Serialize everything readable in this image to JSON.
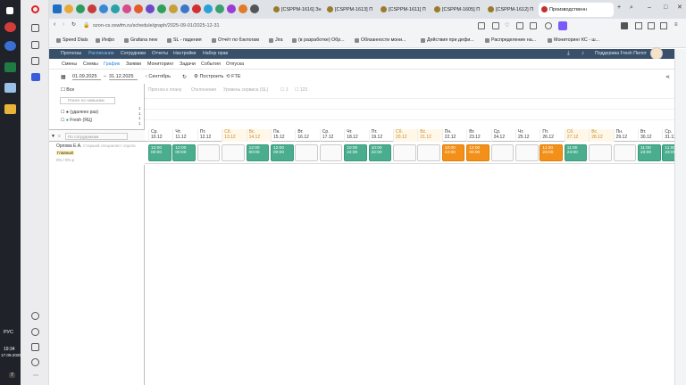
{
  "taskbar": {
    "lang": "РУС",
    "time": "19:34",
    "date": "17.09.2025",
    "notif": "7"
  },
  "opera_sidebar": {
    "badge": "91"
  },
  "tabs": [
    {
      "label": "[CSPPM-1616] Зн"
    },
    {
      "label": "[CSPPM-1613] П"
    },
    {
      "label": "[CSPPM-1611] П"
    },
    {
      "label": "[CSPPM-1605] П"
    },
    {
      "label": "[CSPPM-1612] П"
    },
    {
      "label": "Производственн"
    }
  ],
  "address": {
    "url": "ozon-cs.oswfm.ru/schedule/graph/2025-09-01/2025-12-31"
  },
  "bookmarks": [
    {
      "label": "Speed Dials"
    },
    {
      "label": "Инфо"
    },
    {
      "label": "Grafana new"
    },
    {
      "label": "SL - падения"
    },
    {
      "label": "Отчёт по бэклогам"
    },
    {
      "label": "Jira"
    },
    {
      "label": "(в разработке) Обр..."
    },
    {
      "label": "Обязанности мони..."
    },
    {
      "label": "Действия при дефи..."
    },
    {
      "label": "Распределение на..."
    },
    {
      "label": "Мониторинг КС - ш..."
    }
  ],
  "appnav": {
    "items": [
      "Прогнозы",
      "Расписание",
      "Сотрудники",
      "Отчеты",
      "Настройки",
      "Набор прав"
    ],
    "support": "Поддержка Fresh Пилот"
  },
  "subnav": {
    "items": [
      "Смены",
      "Схемы",
      "График",
      "Заявки",
      "Мониторинг",
      "Задачи",
      "События",
      "Отпуска"
    ]
  },
  "toolbar": {
    "date_from": "01.09.2025",
    "date_to": "31.12.2025",
    "month": "Сентябрь",
    "build": "Построить",
    "fte": "FTE"
  },
  "chart_tabs": {
    "forecast": "Прогноз к плану",
    "deviation": "Отклонения",
    "sl": "Уровень сервиса (SL)",
    "cb1": "1",
    "cb2": "123"
  },
  "filters": {
    "all": "Все",
    "search_ph": "Поиск по навыкам",
    "skill1": "(удалено раз)",
    "skill2": "Fresh (ЯЦ)",
    "emp_search_ph": "По сотрудникам"
  },
  "employee": {
    "name": "Орлова Е.А.",
    "role": "Старший специалист отдела",
    "tag": "Главный",
    "extra": "0% / 0% р"
  },
  "days": [
    {
      "wd": "Ср.",
      "d": "10.12",
      "we": false
    },
    {
      "wd": "Чт.",
      "d": "11.12",
      "we": false
    },
    {
      "wd": "Пт.",
      "d": "12.12",
      "we": false
    },
    {
      "wd": "Сб.",
      "d": "13.12",
      "we": true
    },
    {
      "wd": "Вс.",
      "d": "14.12",
      "we": true
    },
    {
      "wd": "Пн.",
      "d": "15.12",
      "we": false
    },
    {
      "wd": "Вт.",
      "d": "16.12",
      "we": false
    },
    {
      "wd": "Ср.",
      "d": "17.12",
      "we": false
    },
    {
      "wd": "Чт.",
      "d": "18.12",
      "we": false
    },
    {
      "wd": "Пт.",
      "d": "19.12",
      "we": false
    },
    {
      "wd": "Сб.",
      "d": "20.12",
      "we": true
    },
    {
      "wd": "Вс.",
      "d": "21.12",
      "we": true
    },
    {
      "wd": "Пн.",
      "d": "22.12",
      "we": false
    },
    {
      "wd": "Вт.",
      "d": "23.12",
      "we": false
    },
    {
      "wd": "Ср.",
      "d": "24.12",
      "we": false
    },
    {
      "wd": "Чт.",
      "d": "25.12",
      "we": false
    },
    {
      "wd": "Пт.",
      "d": "26.12",
      "we": false
    },
    {
      "wd": "Сб.",
      "d": "27.12",
      "we": true
    },
    {
      "wd": "Вс.",
      "d": "28.12",
      "we": true
    },
    {
      "wd": "Пн.",
      "d": "29.12",
      "we": false
    },
    {
      "wd": "Вт.",
      "d": "30.12",
      "we": false
    },
    {
      "wd": "Ср.",
      "d": "31.12",
      "we": false
    }
  ],
  "shifts": [
    {
      "t": "g",
      "a": "12:00",
      "b": "00:00"
    },
    {
      "t": "g",
      "a": "12:00",
      "b": "00:00"
    },
    {
      "t": "e"
    },
    {
      "t": "e"
    },
    {
      "t": "g",
      "a": "12:00",
      "b": "00:00"
    },
    {
      "t": "g",
      "a": "12:00",
      "b": "00:00"
    },
    {
      "t": "e"
    },
    {
      "t": "e"
    },
    {
      "t": "g",
      "a": "10:00",
      "b": "22:00"
    },
    {
      "t": "g",
      "a": "10:00",
      "b": "22:00"
    },
    {
      "t": "e"
    },
    {
      "t": "e"
    },
    {
      "t": "o",
      "a": "10:00",
      "b": "22:00"
    },
    {
      "t": "o",
      "a": "12:00",
      "b": "00:00"
    },
    {
      "t": "e"
    },
    {
      "t": "e"
    },
    {
      "t": "o",
      "a": "11:00",
      "b": "23:00"
    },
    {
      "t": "g",
      "a": "11:00",
      "b": "23:00"
    },
    {
      "t": "e"
    },
    {
      "t": "e"
    },
    {
      "t": "g",
      "a": "11:00",
      "b": "23:00"
    },
    {
      "t": "g",
      "a": "11:00",
      "b": "23:00"
    }
  ],
  "colors": {
    "green": "#4aae8e",
    "orange": "#f39019",
    "nav": "#38506a"
  }
}
